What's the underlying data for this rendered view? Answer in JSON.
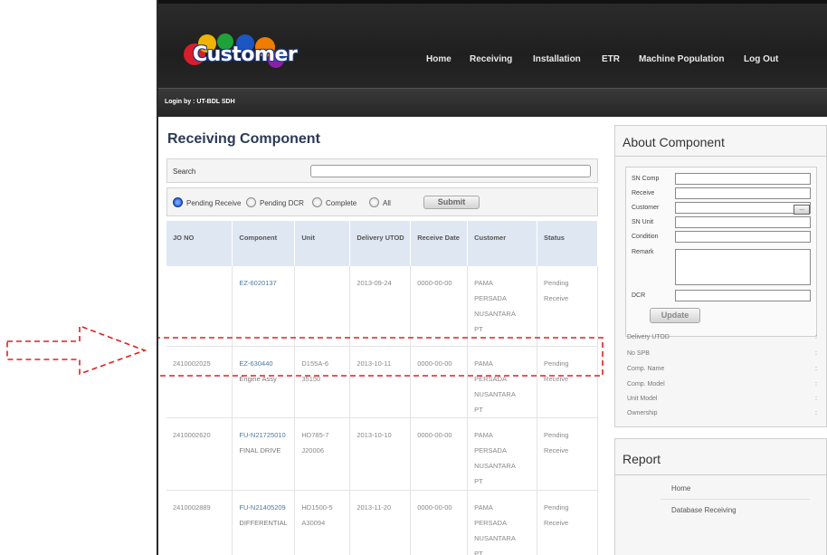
{
  "header": {
    "logo_text": "Customer",
    "nav": [
      "Home",
      "Receiving",
      "Installation",
      "ETR",
      "Machine Population",
      "Log Out"
    ]
  },
  "login": {
    "text": "Login by : UT-BDL SDH"
  },
  "main": {
    "title": "Receiving Component",
    "search_label": "Search",
    "search_value": "",
    "filters": [
      {
        "label": "Pending Receive",
        "selected": true
      },
      {
        "label": "Pending DCR",
        "selected": false
      },
      {
        "label": "Complete",
        "selected": false
      },
      {
        "label": "All",
        "selected": false
      }
    ],
    "submit_label": "Submit"
  },
  "table": {
    "columns": [
      "JO NO",
      "Component",
      "Unit",
      "Delivery UTOD",
      "Receive Date",
      "Customer",
      "Status"
    ],
    "rows": [
      {
        "jo": "",
        "component": "EZ-6020137",
        "component_desc": "",
        "unit": "",
        "unit_sn": "",
        "delivery": "2013-09-24",
        "receive": "0000-00-00",
        "customer": [
          "PAMA",
          "PERSADA",
          "NUSANTARA",
          "PT"
        ],
        "status": [
          "Pending",
          "Receive"
        ]
      },
      {
        "jo": "2410002025",
        "component": "EZ-630440",
        "component_desc": "Engine Assy",
        "unit": "D155A-6",
        "unit_sn": "35150",
        "delivery": "2013-10-11",
        "receive": "0000-00-00",
        "customer": [
          "PAMA",
          "PERSADA",
          "NUSANTARA",
          "PT"
        ],
        "status": [
          "Pending",
          "Receive"
        ]
      },
      {
        "jo": "2410002620",
        "component": "FU-N21725010",
        "component_desc": "FINAL DRIVE",
        "unit": "HD785-7",
        "unit_sn": "J20006",
        "delivery": "2013-10-10",
        "receive": "0000-00-00",
        "customer": [
          "PAMA",
          "PERSADA",
          "NUSANTARA",
          "PT"
        ],
        "status": [
          "Pending",
          "Receive"
        ]
      },
      {
        "jo": "2410002889",
        "component": "FU-N21405209",
        "component_desc": "DIFFERENTIAL",
        "unit": "HD1500-5",
        "unit_sn": "A30094",
        "delivery": "2013-11-20",
        "receive": "0000-00-00",
        "customer": [
          "PAMA",
          "PERSADA",
          "NUSANTARA",
          "PT"
        ],
        "status": [
          "Pending",
          "Receive"
        ]
      }
    ]
  },
  "about": {
    "title": "About Component",
    "fields": [
      "SN Comp",
      "Receive",
      "Customer",
      "SN Unit",
      "Condition",
      "Remark",
      "DCR"
    ],
    "lookup_label": "...",
    "update_label": "Update",
    "info": [
      {
        "label": "Delivery UTOD",
        "value": ":"
      },
      {
        "label": "No SPB",
        "value": ":"
      },
      {
        "label": "Comp. Name",
        "value": ":"
      },
      {
        "label": "Comp. Model",
        "value": ":"
      },
      {
        "label": "Unit Model",
        "value": ":"
      },
      {
        "label": "Ownership",
        "value": ":"
      }
    ]
  },
  "report": {
    "title": "Report",
    "links": [
      "Home",
      "Database Receiving"
    ]
  },
  "colors": {
    "annotation": "#e02020",
    "header_bg": "#262626",
    "table_header_bg": "#dfe8f2",
    "link": "#4d7a9e"
  }
}
